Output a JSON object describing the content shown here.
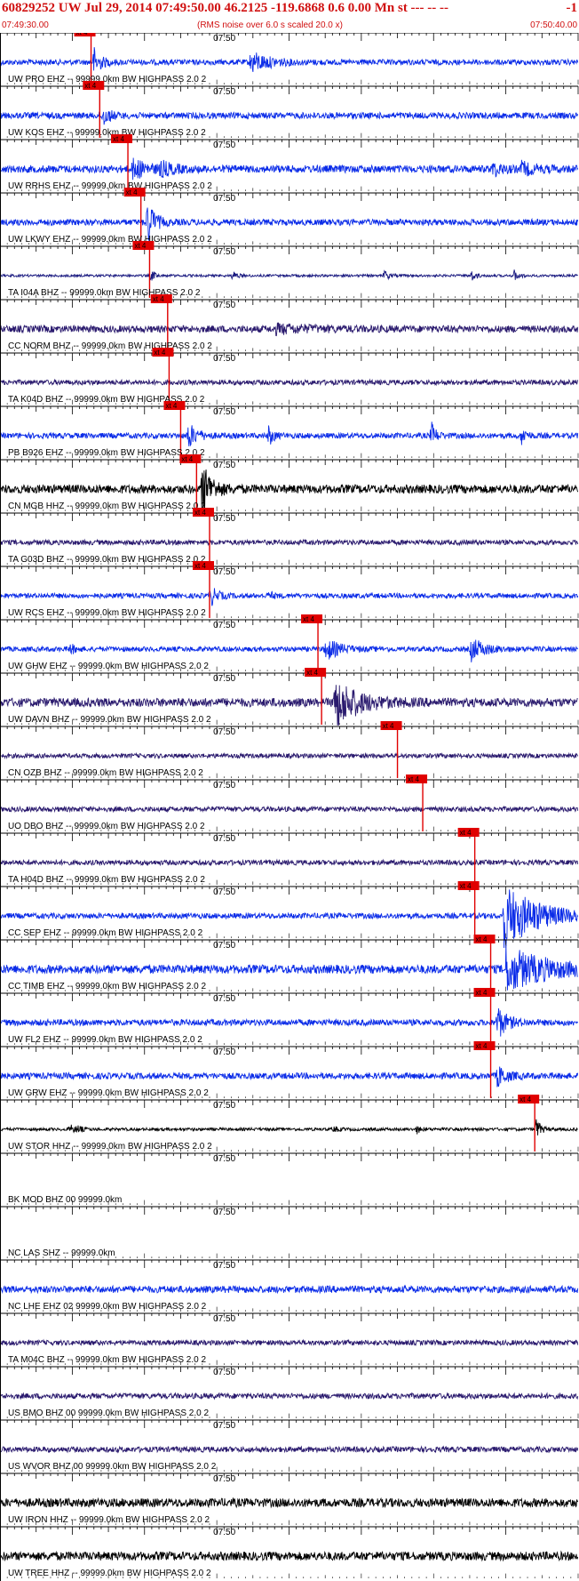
{
  "header": {
    "title": "60829252 UW Jul 29, 2014 07:49:50.00   46.2125 -119.6868  0.6 0.00 Mn st --- -- --",
    "title_right": "-1",
    "start_time": "07:49:30.00",
    "note": "(RMS noise over 6.0 s scaled 20.0 x)",
    "end_time": "07:50:40.00"
  },
  "chart_data": {
    "type": "seismogram",
    "minute_label": "07:50",
    "pick_label": "xt 4",
    "traces": [
      {
        "label": "UW PRO EHZ -- 99999.0km BW  HIGHPASS  2.0  2",
        "color": "#0b2ce8",
        "pick_s": 12.6,
        "noise": 0.22,
        "events": [
          [
            12.8,
            1.4,
            1.5
          ],
          [
            34.5,
            0.9,
            4.0
          ]
        ]
      },
      {
        "label": "UW KOS EHZ -- 99999.0km BW  HIGHPASS  2.0  2",
        "color": "#0b2ce8",
        "pick_s": 13.8,
        "noise": 0.25,
        "events": [
          [
            14.0,
            1.0,
            1.5
          ]
        ]
      },
      {
        "label": "UW RRHS EHZ -- 99999.0km BW  HIGHPASS  2.0  2",
        "color": "#0b2ce8",
        "pick_s": 17.7,
        "noise": 0.3,
        "events": [
          [
            18.2,
            0.9,
            3.0
          ],
          [
            22.0,
            0.5,
            3.0
          ],
          [
            68.0,
            0.6,
            2.0
          ],
          [
            72.0,
            0.5,
            3.0
          ]
        ]
      },
      {
        "label": "UW LKWY EHZ -- 99999.0km BW  HIGHPASS  2.0  2",
        "color": "#0b2ce8",
        "pick_s": 19.5,
        "noise": 0.25,
        "events": [
          [
            20.2,
            2.4,
            1.5
          ]
        ]
      },
      {
        "label": "TA I04A BHZ -- 99999.0km BW  HIGHPASS  2.0  2",
        "color": "#1a1a80",
        "pick_s": 20.7,
        "noise": 0.1,
        "events": [
          [
            20.7,
            0.6,
            1.0
          ],
          [
            32.0,
            0.5,
            1.0
          ],
          [
            53.0,
            0.6,
            1.0
          ],
          [
            65.0,
            0.6,
            1.0
          ],
          [
            71.0,
            0.6,
            1.0
          ]
        ]
      },
      {
        "label": "CC NORM BHZ -- 99999.0km BW  HIGHPASS  2.0  2",
        "color": "#2a1a6e",
        "pick_s": 23.2,
        "noise": 0.28,
        "events": [
          [
            38.0,
            0.3,
            8.0
          ]
        ]
      },
      {
        "label": "TA K04D BHZ -- 99999.0km BW  HIGHPASS  2.0  2",
        "color": "#2a1a6e",
        "pick_s": 23.4,
        "noise": 0.2,
        "events": []
      },
      {
        "label": "PB B926 EHZ -- 99999.0km BW  HIGHPASS  2.0  2",
        "color": "#0b2ce8",
        "pick_s": 25.0,
        "noise": 0.22,
        "events": [
          [
            25.8,
            1.2,
            2.0
          ],
          [
            37.0,
            1.1,
            1.0
          ],
          [
            59.5,
            1.4,
            1.0
          ],
          [
            72.0,
            1.0,
            1.0
          ]
        ]
      },
      {
        "label": "CN MGB HHZ -- 99999.0km BW  HIGHPASS  2.0  2",
        "color": "#000000",
        "pick_s": 27.2,
        "noise": 0.35,
        "events": [
          [
            27.8,
            2.6,
            2.0
          ]
        ]
      },
      {
        "label": "TA G03D BHZ -- 99999.0km BW  HIGHPASS  2.0  2",
        "color": "#2a1a6e",
        "pick_s": 29.0,
        "noise": 0.2,
        "events": []
      },
      {
        "label": "UW RCS EHZ -- 99999.0km BW  HIGHPASS  2.0  2",
        "color": "#0b2ce8",
        "pick_s": 29.0,
        "noise": 0.2,
        "events": [
          [
            29.0,
            0.9,
            1.5
          ],
          [
            37.0,
            0.4,
            1.0
          ]
        ]
      },
      {
        "label": "UW GHW EHZ -- 99999.0km BW  HIGHPASS  2.0  2",
        "color": "#0b2ce8",
        "pick_s": 44.0,
        "noise": 0.2,
        "events": [
          [
            9.5,
            0.6,
            1.0
          ],
          [
            44.8,
            1.0,
            3.0
          ],
          [
            65.0,
            1.0,
            3.0
          ]
        ]
      },
      {
        "label": "UW DAVN BHZ -- 99999.0km BW  HIGHPASS  2.0  2",
        "color": "#2a1a6e",
        "pick_s": 44.5,
        "noise": 0.35,
        "events": [
          [
            46.0,
            2.2,
            5.0
          ]
        ]
      },
      {
        "label": "CN OZB BHZ -- 99999.0km BW  HIGHPASS  2.0  2",
        "color": "#2a1a6e",
        "pick_s": 55.0,
        "noise": 0.18,
        "events": []
      },
      {
        "label": "UO DBO BHZ -- 99999.0km BW  HIGHPASS  2.0  2",
        "color": "#2a1a6e",
        "pick_s": 58.5,
        "noise": 0.2,
        "events": []
      },
      {
        "label": "TA H04D BHZ -- 99999.0km BW  HIGHPASS  2.0  2",
        "color": "#2a1a6e",
        "pick_s": 65.7,
        "noise": 0.2,
        "events": []
      },
      {
        "label": "CC SEP EHZ -- 99999.0km BW  HIGHPASS  2.0  2",
        "color": "#0b2ce8",
        "pick_s": 65.7,
        "noise": 0.22,
        "events": [
          [
            69.5,
            2.6,
            8.0
          ]
        ]
      },
      {
        "label": "CC TIMB EHZ -- 99999.0km BW  HIGHPASS  2.0  2",
        "color": "#0b2ce8",
        "pick_s": 67.9,
        "noise": 0.35,
        "events": [
          [
            69.8,
            1.8,
            9.0
          ]
        ]
      },
      {
        "label": "UW FL2 EHZ -- 99999.0km BW  HIGHPASS  2.0  2",
        "color": "#0b2ce8",
        "pick_s": 67.9,
        "noise": 0.25,
        "events": [
          [
            68.6,
            1.6,
            2.0
          ]
        ]
      },
      {
        "label": "UW GRW EHZ -- 99999.0km BW  HIGHPASS  2.0  2",
        "color": "#0b2ce8",
        "pick_s": 67.9,
        "noise": 0.25,
        "events": [
          [
            68.6,
            1.0,
            2.0
          ]
        ]
      },
      {
        "label": "UW STOR HHZ -- 99999.0km BW  HIGHPASS  2.0  2",
        "color": "#000000",
        "pick_s": 74.0,
        "noise": 0.12,
        "events": [
          [
            9.5,
            0.5,
            1.0
          ],
          [
            10.5,
            0.4,
            1.0
          ],
          [
            46.0,
            0.3,
            1.0
          ],
          [
            57.5,
            0.4,
            1.0
          ],
          [
            74.0,
            1.2,
            1.0
          ]
        ]
      },
      {
        "label": "BK MOD BHZ 00 99999.0km",
        "color": "#000000",
        "pick_s": null,
        "noise": 0,
        "events": []
      },
      {
        "label": "NC LAS SHZ -- 99999.0km",
        "color": "#000000",
        "pick_s": null,
        "noise": 0,
        "events": []
      },
      {
        "label": "NC LHE EHZ 02 99999.0km BW  HIGHPASS  2.0  2",
        "color": "#0b2ce8",
        "pick_s": null,
        "noise": 0.28,
        "events": []
      },
      {
        "label": "TA M04C BHZ -- 99999.0km BW  HIGHPASS  2.0  2",
        "color": "#2a1a6e",
        "pick_s": null,
        "noise": 0.2,
        "events": []
      },
      {
        "label": "US BMO BHZ 00 99999.0km BW  HIGHPASS  2.0  2",
        "color": "#2a1a6e",
        "pick_s": null,
        "noise": 0.22,
        "events": []
      },
      {
        "label": "US WVOR BHZ 00 99999.0km BW  HIGHPASS  2.0  2",
        "color": "#2a1a6e",
        "pick_s": null,
        "noise": 0.22,
        "events": []
      },
      {
        "label": "UW IRON HHZ -- 99999.0km BW  HIGHPASS  2.0  2",
        "color": "#000000",
        "pick_s": null,
        "noise": 0.35,
        "events": []
      },
      {
        "label": "UW TREE HHZ -- 99999.0km BW  HIGHPASS  2.0  2",
        "color": "#000000",
        "pick_s": null,
        "noise": 0.35,
        "events": []
      }
    ],
    "x_range_s": [
      0,
      80
    ],
    "minute_mark_s": 30
  }
}
